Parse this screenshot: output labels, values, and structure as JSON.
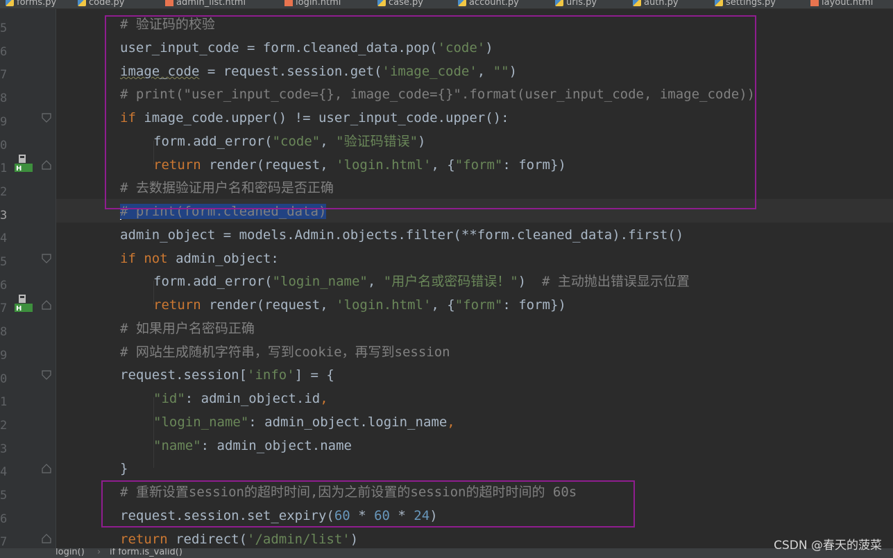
{
  "tabs": [
    {
      "label": "forms.py"
    },
    {
      "label": "code.py"
    },
    {
      "label": "admin_list.html"
    },
    {
      "label": "login.html"
    },
    {
      "label": "case.py"
    },
    {
      "label": "account.py"
    },
    {
      "label": "urls.py"
    },
    {
      "label": "auth.py"
    },
    {
      "label": "settings.py"
    },
    {
      "label": "layout.html"
    }
  ],
  "gutter": {
    "line_numbers": [
      "5",
      "6",
      "7",
      "8",
      "9",
      "0",
      "1",
      "2",
      "3",
      "4",
      "5",
      "6",
      "7",
      "8",
      "9",
      "0",
      "1",
      "2",
      "3",
      "4",
      "5",
      "6",
      "7"
    ]
  },
  "code": {
    "l1_comment": "# 验证码的校验",
    "l2_a": "user_input_code = form.cleaned_data.pop(",
    "l2_str": "'code'",
    "l2_b": ")",
    "l3_a": "image_code",
    "l3_b": " = request.session.get(",
    "l3_str1": "'image_code'",
    "l3_c": ", ",
    "l3_str2": "\"\"",
    "l3_d": ")",
    "l4_comment": "# print(\"user_input_code={}, image_code={}\".format(user_input_code, image_code))",
    "l5_kw": "if",
    "l5_a": " image_code.upper() != user_input_code.upper():",
    "l6_a": "form.add_error(",
    "l6_str1": "\"code\"",
    "l6_b": ", ",
    "l6_str2": "\"验证码错误\"",
    "l6_c": ")",
    "l7_kw": "return",
    "l7_a": " render(request, ",
    "l7_str1": "'login.html'",
    "l7_b": ", {",
    "l7_str2": "\"form\"",
    "l7_c": ": form})",
    "l8_comment": "# 去数据验证用户名和密码是否正确",
    "l9_comment": "# print(form.cleaned_data)",
    "l10_a": "admin_object = models.Admin.objects.filter(**form.cleaned_data).first()",
    "l11_kw1": "if",
    "l11_kw2": "not",
    "l11_a": " admin_object:",
    "l12_a": "form.add_error(",
    "l12_str1": "\"login_name\"",
    "l12_b": ", ",
    "l12_str2": "\"用户名或密码错误！\"",
    "l12_c": ")  ",
    "l12_comment": "# 主动抛出错误显示位置",
    "l13_kw": "return",
    "l13_a": " render(request, ",
    "l13_str1": "'login.html'",
    "l13_b": ", {",
    "l13_str2": "\"form\"",
    "l13_c": ": form})",
    "l14_comment": "# 如果用户名密码正确",
    "l15_comment": "# 网站生成随机字符串，写到cookie，再写到session",
    "l16_a": "request.session[",
    "l16_str": "'info'",
    "l16_b": "] = {",
    "l17_str": "\"id\"",
    "l17_a": ": admin_object.id",
    "l17_comma": ",",
    "l18_str": "\"login_name\"",
    "l18_a": ": admin_object.login_name",
    "l18_comma": ",",
    "l19_str": "\"name\"",
    "l19_a": ": admin_object.name",
    "l20_a": "}",
    "l21_comment": "# 重新设置session的超时时间,因为之前设置的session的超时时间的 60s",
    "l22_a": "request.session.set_expiry(",
    "l22_n1": "60",
    "l22_op1": " * ",
    "l22_n2": "60",
    "l22_op2": " * ",
    "l22_n3": "24",
    "l22_b": ")",
    "l23_kw": "return",
    "l23_a": " redirect(",
    "l23_str": "'/admin/list'",
    "l23_b": ")"
  },
  "breadcrumb": {
    "item1": "login()",
    "sep": "›",
    "item2": "if form.is_valid()"
  },
  "watermark": "CSDN @春天的菠菜",
  "colors": {
    "background": "#2b2b2b",
    "keyword": "#cc7832",
    "string": "#6a8759",
    "number": "#6897bb",
    "comment": "#808080",
    "annotation_box": "#8f1d8f",
    "selection": "#214283"
  }
}
